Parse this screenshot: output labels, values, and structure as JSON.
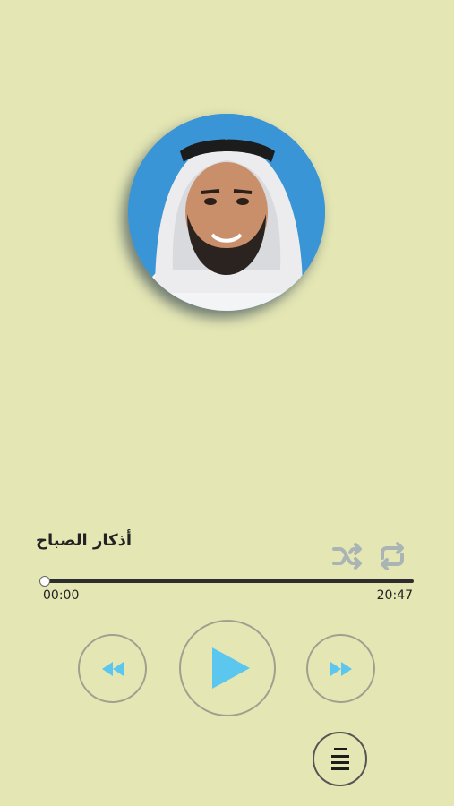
{
  "colors": {
    "background": "#e4e6b4",
    "accent": "#5bc6ee",
    "muted_icon": "#aab4b4",
    "ring": "#a0a08f"
  },
  "track": {
    "title": "أذكار الصباح",
    "current_time": "00:00",
    "total_time": "20:47",
    "progress": 0
  },
  "icons": {
    "shuffle": "shuffle-icon",
    "repeat": "repeat-icon",
    "rewind": "rewind-icon",
    "play": "play-icon",
    "fast_forward": "fast-forward-icon",
    "playlist": "playlist-menu-icon"
  }
}
